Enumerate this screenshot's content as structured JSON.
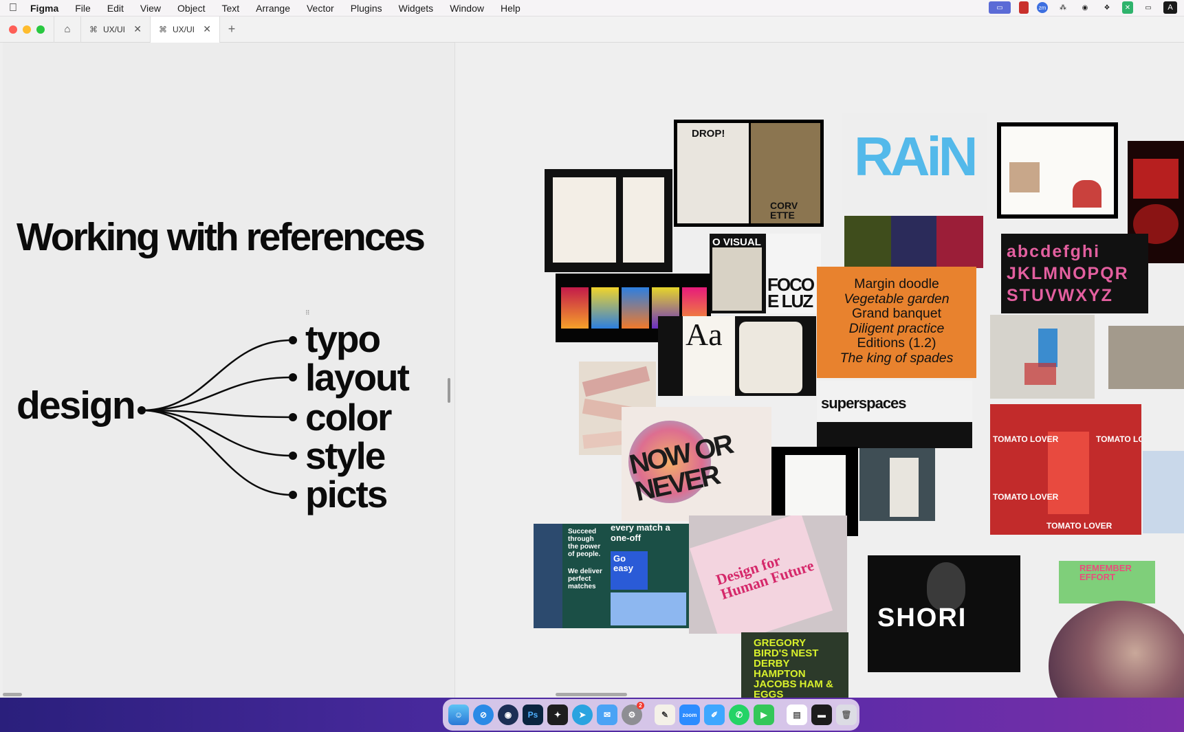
{
  "menubar": {
    "app_name": "Figma",
    "items": [
      "File",
      "Edit",
      "View",
      "Object",
      "Text",
      "Arrange",
      "Vector",
      "Plugins",
      "Widgets",
      "Window",
      "Help"
    ],
    "status_icons": [
      "display-icon",
      "flag-icon",
      "zoom-icon",
      "grid-icon",
      "eye-icon",
      "dropbox-icon",
      "tool-icon",
      "monitor-icon",
      "input-source-icon"
    ],
    "input_source": "A"
  },
  "tabs": [
    {
      "label": "UX/UI",
      "active": false
    },
    {
      "label": "UX/UI",
      "active": true
    }
  ],
  "slide": {
    "title": "Working with references",
    "root": "design",
    "branches": [
      "typo",
      "layout",
      "color",
      "style",
      "picts"
    ]
  },
  "moodboard": {
    "note_lines": [
      "Margin doodle",
      "Vegetable garden",
      "Grand banquet",
      "Diligent practice",
      "Editions (1.2)",
      "The king of spades"
    ],
    "tiles": {
      "drop": "DROP!",
      "corvette": "CORV ETTE",
      "rain": "RAiN",
      "visual": "O VISUAL",
      "foco": "FOCO E LUZ",
      "aa": "Aa",
      "alphabet": "abcdefghi JKLMNOPQR STUVWXYZ",
      "superspaces": "superspaces",
      "now": "NOW OR NEVER",
      "tomato": "TOMATO LOVER",
      "blu": "Succeed through the power of people.",
      "deliver": "We deliver perfect matches",
      "every": "every match a one-off",
      "go": "Go easy",
      "design": "Design for Human Future",
      "gregory": "GREGORY BIRD'S NEST DERBY HAMPTON JACOBS HAM & EGGS",
      "shori": "SHORI",
      "remember": "REMEMBER EFFORT"
    }
  },
  "dock": {
    "apps": [
      "finder-icon",
      "safari-icon",
      "cinema-icon",
      "photoshop-icon",
      "figma-icon",
      "telegram-icon",
      "mail-icon",
      "settings-icon",
      "notes-icon",
      "zoom-icon",
      "pen-icon",
      "whatsapp-icon",
      "facetime-icon",
      "preview-icon",
      "terminal-icon",
      "trash-icon"
    ],
    "labels": {
      "photoshop": "Ps",
      "zoom": "zoom"
    },
    "badge_settings": "2"
  }
}
